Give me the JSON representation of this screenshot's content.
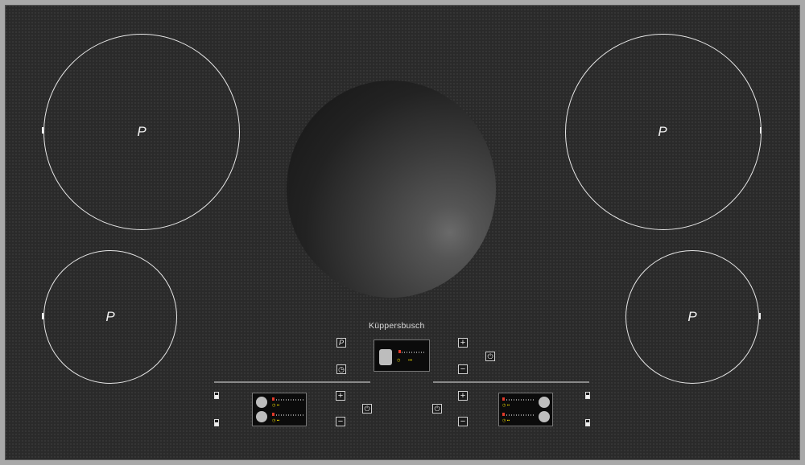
{
  "brand": "Küppersbusch",
  "zones": {
    "front_left": "P",
    "rear_left": "P",
    "rear_right": "P",
    "front_right": "P"
  },
  "keys": {
    "power": "P",
    "timer": "◷",
    "plus": "+",
    "minus": "−",
    "onoff": "⏻"
  },
  "colors": {
    "glass": "#2a2a2a",
    "ring": "#e6e6e6",
    "display_yellow": "#e8d400",
    "display_red": "#e23a2a"
  }
}
